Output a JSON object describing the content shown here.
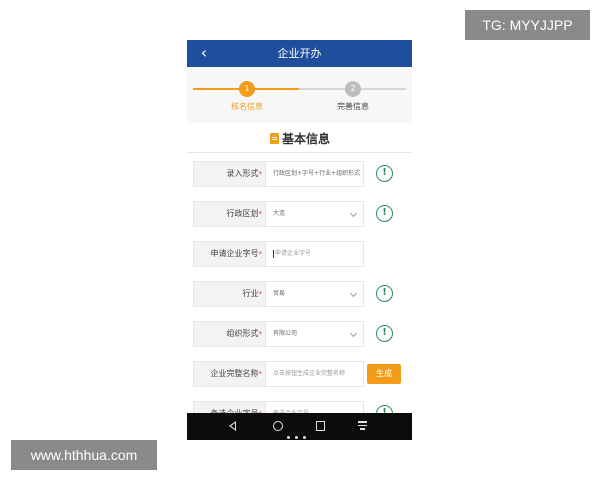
{
  "watermarks": {
    "top_right": "TG: MYYJJPP",
    "bottom_left": "www.hthhua.com"
  },
  "app": {
    "title": "企业开办",
    "back_icon": "back-arrow-icon"
  },
  "stepper": {
    "steps": [
      {
        "number": "1",
        "label": "核名信息",
        "state": "active"
      },
      {
        "number": "2",
        "label": "完善信息",
        "state": "pending"
      }
    ],
    "active_color": "#f39c1a",
    "pending_color": "#bdbdbd"
  },
  "section": {
    "icon": "document-icon",
    "title": "基本信息"
  },
  "form": {
    "required_mark": "*",
    "rows": [
      {
        "label": "录入形式",
        "value": "行政区划+字号+行业+组织形式",
        "kind": "text",
        "has_info": true
      },
      {
        "label": "行政区划",
        "value": "大连",
        "kind": "select",
        "has_info": true
      },
      {
        "label": "申请企业字号",
        "placeholder": "申请企业字号",
        "kind": "input",
        "has_info": false
      },
      {
        "label": "行业",
        "value": "贸易",
        "kind": "select",
        "has_info": true
      },
      {
        "label": "组织形式",
        "value": "有限公司",
        "kind": "select",
        "has_info": true
      },
      {
        "label": "企业完整名称",
        "placeholder": "点击按钮生成企业完整名称",
        "kind": "generate",
        "has_info": false
      },
      {
        "label": "备选企业字号",
        "placeholder": "备选企业字号",
        "kind": "input",
        "has_info": true
      }
    ],
    "info_symbol": "!",
    "generate_label": "生成"
  },
  "colors": {
    "nav_bar": "#1f4f9c",
    "accent": "#f39c1a",
    "info": "#2e8b57"
  },
  "system_nav": {
    "icons": [
      "back-triangle-icon",
      "home-circle-icon",
      "recent-square-icon",
      "menu-icon"
    ]
  }
}
